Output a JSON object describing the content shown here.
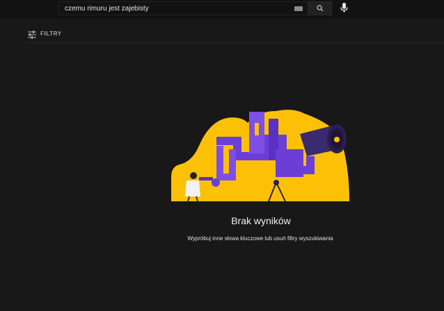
{
  "search": {
    "query": "czemu rimuru jest zajebisty"
  },
  "filters": {
    "label": "FILTRY"
  },
  "empty_state": {
    "title": "Brak wyników",
    "subtitle": "Wypróbuj inne słowa kluczowe lub usuń filtry wyszukiwania"
  },
  "colors": {
    "background": "#181818",
    "illustration_yellow": "#fcc107",
    "illustration_purple": "#6b3fd6"
  }
}
